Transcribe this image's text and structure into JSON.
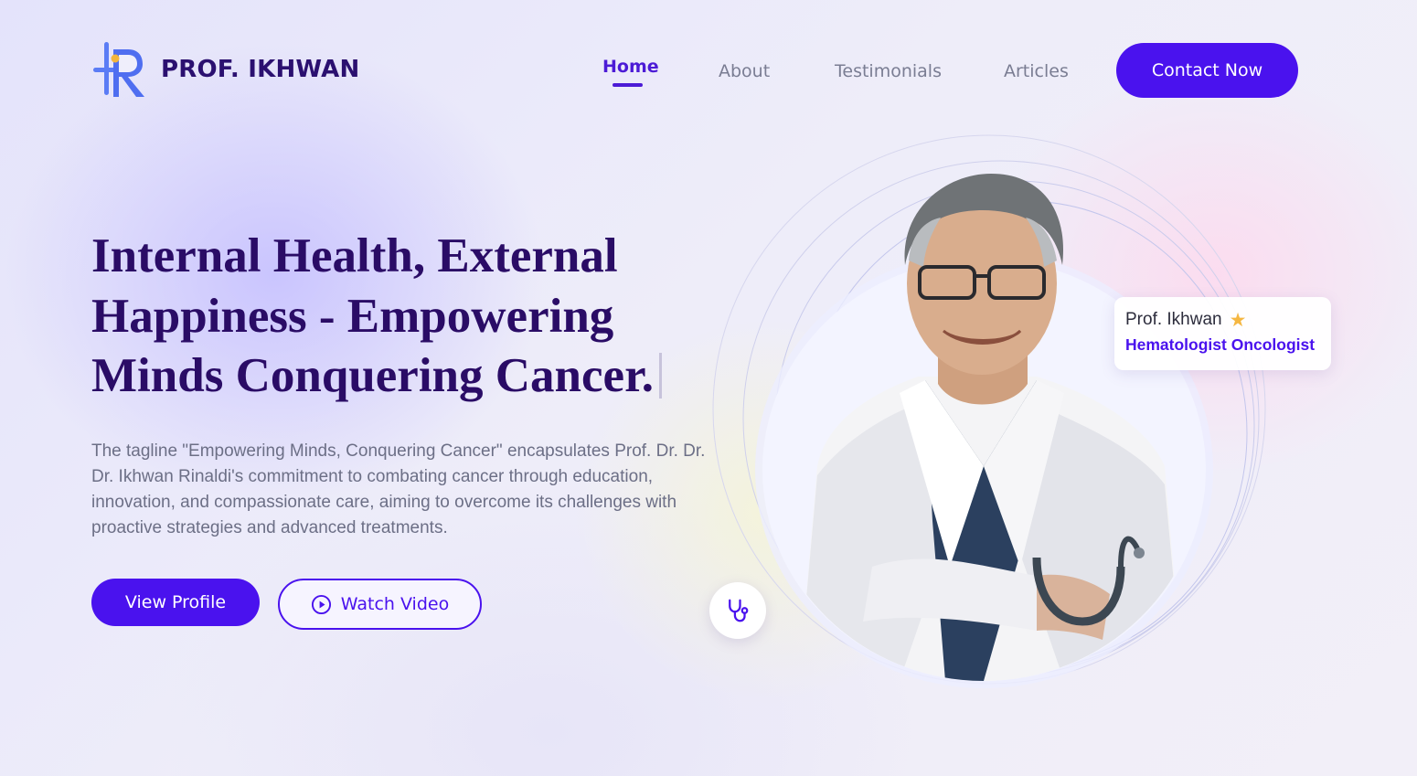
{
  "brand": {
    "name": "PROF. IKHWAN",
    "logo_icon": "monogram-ir-logo",
    "accent_color": "#4a12ee",
    "heading_color": "#2a0c66"
  },
  "nav": {
    "items": [
      {
        "label": "Home",
        "active": true
      },
      {
        "label": "About",
        "active": false
      },
      {
        "label": "Testimonials",
        "active": false
      },
      {
        "label": "Articles",
        "active": false
      }
    ],
    "cta_label": "Contact Now"
  },
  "hero": {
    "headline": "Internal Health, External Happiness - Empowering Minds Conquering Cancer.",
    "tagline": "The tagline \"Empowering Minds, Conquering Cancer\" encapsulates Prof. Dr. Dr. Dr. Ikhwan Rinaldi's commitment to combating cancer through education, innovation, and compassionate care, aiming to overcome its challenges with proactive strategies and advanced treatments.",
    "primary_button": "View Profile",
    "secondary_button": "Watch Video",
    "secondary_button_icon": "play-circle-icon"
  },
  "doctor_card": {
    "name": "Prof. Ikhwan",
    "name_icon": "star-icon",
    "specialty": "Hematologist Oncologist",
    "float_icon": "stethoscope-icon"
  }
}
